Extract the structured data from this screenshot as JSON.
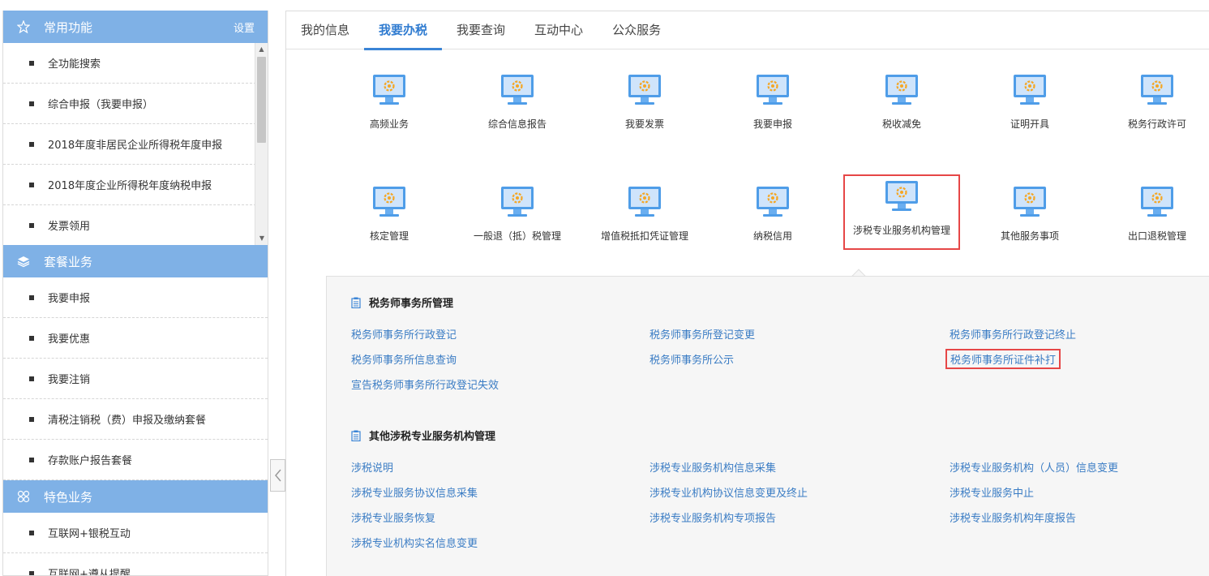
{
  "sidebar": {
    "section1": {
      "title": "常用功能",
      "settings_label": "设置",
      "icon": "star-icon"
    },
    "section1_items": [
      {
        "label": "全功能搜索"
      },
      {
        "label": "综合申报（我要申报）"
      },
      {
        "label": "2018年度非居民企业所得税年度申报"
      },
      {
        "label": "2018年度企业所得税年度纳税申报"
      },
      {
        "label": "发票领用"
      }
    ],
    "section2": {
      "title": "套餐业务",
      "icon": "layers-icon"
    },
    "section2_items": [
      {
        "label": "我要申报"
      },
      {
        "label": "我要优惠"
      },
      {
        "label": "我要注销"
      },
      {
        "label": "清税注销税（费）申报及缴纳套餐"
      },
      {
        "label": "存款账户报告套餐"
      }
    ],
    "section3": {
      "title": "特色业务",
      "icon": "grid-icon"
    },
    "section3_items": [
      {
        "label": "互联网+银税互动"
      },
      {
        "label": "互联网+遵从提醒"
      }
    ]
  },
  "tabs": [
    {
      "label": "我的信息",
      "active": false
    },
    {
      "label": "我要办税",
      "active": true
    },
    {
      "label": "我要查询",
      "active": false
    },
    {
      "label": "互动中心",
      "active": false
    },
    {
      "label": "公众服务",
      "active": false
    }
  ],
  "tiles": [
    {
      "label": "高频业务"
    },
    {
      "label": "综合信息报告"
    },
    {
      "label": "我要发票"
    },
    {
      "label": "我要申报"
    },
    {
      "label": "税收减免"
    },
    {
      "label": "证明开具"
    },
    {
      "label": "税务行政许可"
    },
    {
      "label": "核定管理"
    },
    {
      "label": "一般退（抵）税管理"
    },
    {
      "label": "增值税抵扣凭证管理"
    },
    {
      "label": "纳税信用"
    },
    {
      "label": "涉税专业服务机构管理",
      "selected": true
    },
    {
      "label": "其他服务事项"
    },
    {
      "label": "出口退税管理"
    }
  ],
  "submenu": {
    "group1": {
      "title": "税务师事务所管理",
      "links": [
        {
          "label": "税务师事务所行政登记"
        },
        {
          "label": "税务师事务所登记变更"
        },
        {
          "label": "税务师事务所行政登记终止"
        },
        {
          "label": "税务师事务所信息查询"
        },
        {
          "label": "税务师事务所公示"
        },
        {
          "label": "税务师事务所证件补打",
          "selected": true
        },
        {
          "label": "宣告税务师事务所行政登记失效"
        }
      ]
    },
    "group2": {
      "title": "其他涉税专业服务机构管理",
      "links": [
        {
          "label": "涉税说明"
        },
        {
          "label": "涉税专业服务机构信息采集"
        },
        {
          "label": "涉税专业服务机构（人员）信息变更"
        },
        {
          "label": "涉税专业服务协议信息采集"
        },
        {
          "label": "涉税专业机构协议信息变更及终止"
        },
        {
          "label": "涉税专业服务中止"
        },
        {
          "label": "涉税专业服务恢复"
        },
        {
          "label": "涉税专业服务机构专项报告"
        },
        {
          "label": "涉税专业服务机构年度报告"
        },
        {
          "label": "涉税专业机构实名信息变更"
        }
      ]
    }
  },
  "colors": {
    "accent": "#3a84d6",
    "sidebar_header": "#7fb1e6",
    "link": "#3a7cc4",
    "highlight": "#e64747"
  }
}
